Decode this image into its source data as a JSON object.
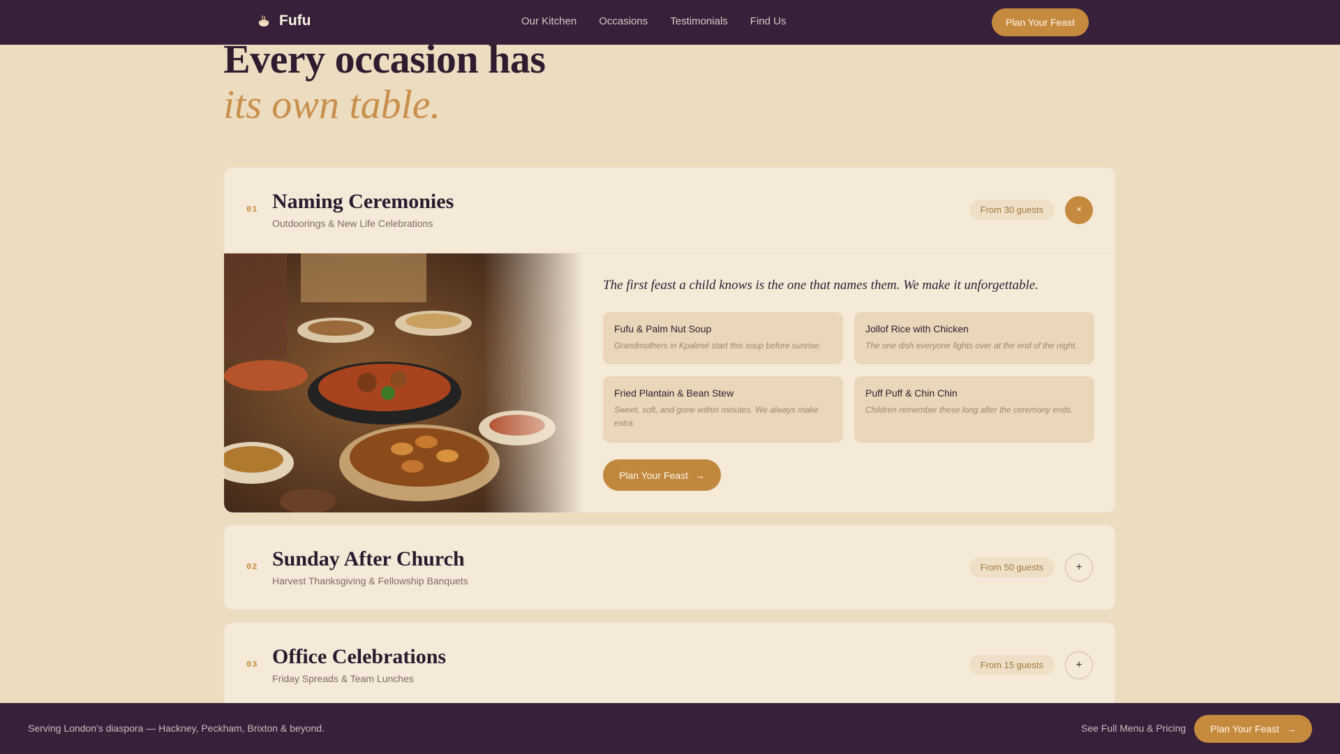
{
  "nav": {
    "brand": "Fufu",
    "brand_icon": "pot-icon",
    "links": [
      "Our Kitchen",
      "Occasions",
      "Testimonials",
      "Find Us"
    ],
    "cta": "Plan Your Feast"
  },
  "hero": {
    "line1": "Every occasion has",
    "line2": "its own table."
  },
  "occasions": [
    {
      "num": "01",
      "title": "Naming Ceremonies",
      "subtitle": "Outdoorings & New Life Celebrations",
      "guests": "From 30 guests",
      "toggle": "×",
      "expanded": true,
      "tagline": "The first feast a child knows is the one that names them. We make it unforgettable.",
      "dishes": [
        {
          "name": "Fufu & Palm Nut Soup",
          "desc": "Grandmothers in Kpalimé start this soup before sunrise."
        },
        {
          "name": "Jollof Rice with Chicken",
          "desc": "The one dish everyone fights over at the end of the night."
        },
        {
          "name": "Fried Plantain & Bean Stew",
          "desc": "Sweet, soft, and gone within minutes. We always make extra."
        },
        {
          "name": "Puff Puff & Chin Chin",
          "desc": "Children remember these long after the ceremony ends."
        }
      ],
      "cta": "Plan Your Feast",
      "cta_icon": "arrow-right-icon"
    },
    {
      "num": "02",
      "title": "Sunday After Church",
      "subtitle": "Harvest Thanksgiving & Fellowship Banquets",
      "guests": "From 50 guests",
      "toggle": "+",
      "expanded": false
    },
    {
      "num": "03",
      "title": "Office Celebrations",
      "subtitle": "Friday Spreads & Team Lunches",
      "guests": "From 15 guests",
      "toggle": "+",
      "expanded": false
    }
  ],
  "footer": {
    "text": "Serving London's diaspora — Hackney, Peckham, Brixton & beyond.",
    "link": "See Full Menu & Pricing",
    "cta": "Plan Your Feast"
  },
  "colors": {
    "background": "#ecdcc0",
    "nav": "#36203a",
    "accent": "#c68a3e",
    "card": "#f5e9d8"
  }
}
